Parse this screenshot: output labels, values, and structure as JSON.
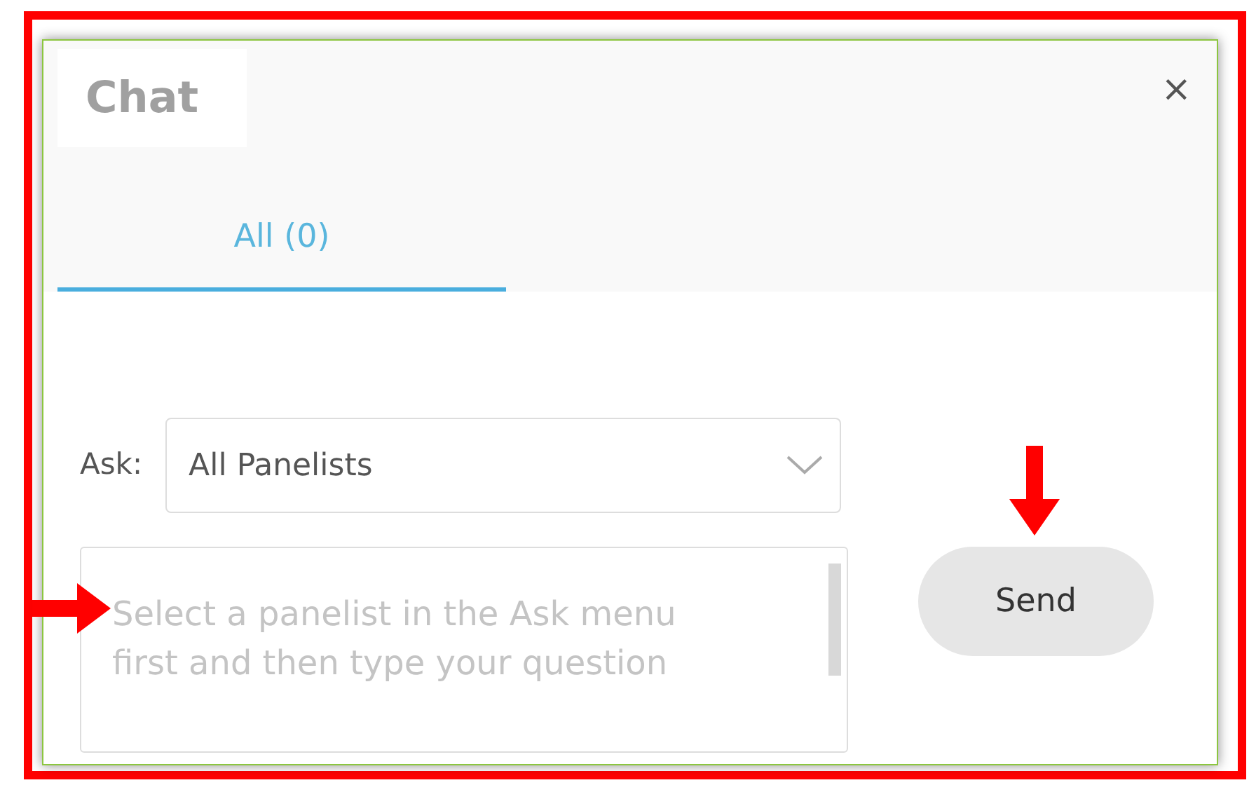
{
  "panel": {
    "title": "Chat",
    "close": "×"
  },
  "tabs": [
    {
      "label": "All (0)",
      "selected": true
    }
  ],
  "ask": {
    "label": "Ask:",
    "value": "All Panelists"
  },
  "message": {
    "placeholder": "Select a panelist in the Ask menu first and then type your question"
  },
  "buttons": [
    {
      "label": "Send"
    }
  ]
}
